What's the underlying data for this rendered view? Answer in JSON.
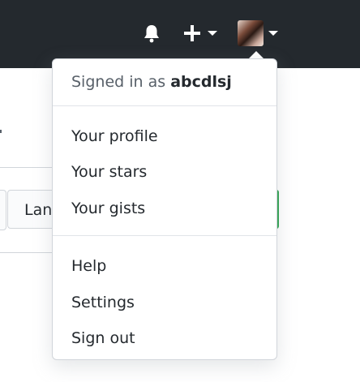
{
  "header": {
    "notifications_icon": "bell-icon",
    "create_icon": "plus-icon",
    "create_caret_icon": "caret-down-icon",
    "avatar_caret_icon": "caret-down-icon",
    "background_color": "#24292e"
  },
  "background": {
    "language_button_label": "Lan",
    "accent_green": "#2ea44f"
  },
  "dropdown": {
    "signed_in_prefix": "Signed in as",
    "username": "abcdlsj",
    "items_group1": [
      {
        "label": "Your profile"
      },
      {
        "label": "Your stars"
      },
      {
        "label": "Your gists"
      }
    ],
    "items_group2": [
      {
        "label": "Help"
      },
      {
        "label": "Settings"
      },
      {
        "label": "Sign out"
      }
    ]
  }
}
